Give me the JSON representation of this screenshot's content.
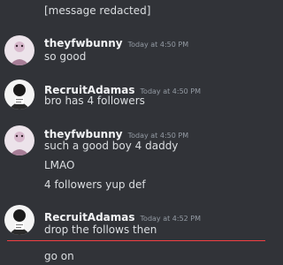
{
  "messages": {
    "top_partial": "[message redacted]",
    "group1": {
      "username": "theyfwbunny",
      "timestamp": "Today at 4:50 PM",
      "lines": [
        "so good"
      ]
    },
    "group2": {
      "username": "RecruitAdamas",
      "timestamp": "Today at 4:50 PM",
      "lines": [
        "bro has 4 followers"
      ]
    },
    "group3": {
      "username": "theyfwbunny",
      "timestamp": "Today at 4:50 PM",
      "lines": [
        "such a good boy 4 daddy",
        "LMAO",
        "4 followers yup def"
      ]
    },
    "group4": {
      "username": "RecruitAdamas",
      "timestamp": "Today at 4:52 PM",
      "lines": [
        "drop the follows then"
      ]
    },
    "new_line": "go on"
  },
  "colors": {
    "background": "#313338",
    "text": "#dbdee1",
    "username": "#f2f3f5",
    "timestamp": "#949ba4",
    "new_divider": "#f23f43"
  }
}
